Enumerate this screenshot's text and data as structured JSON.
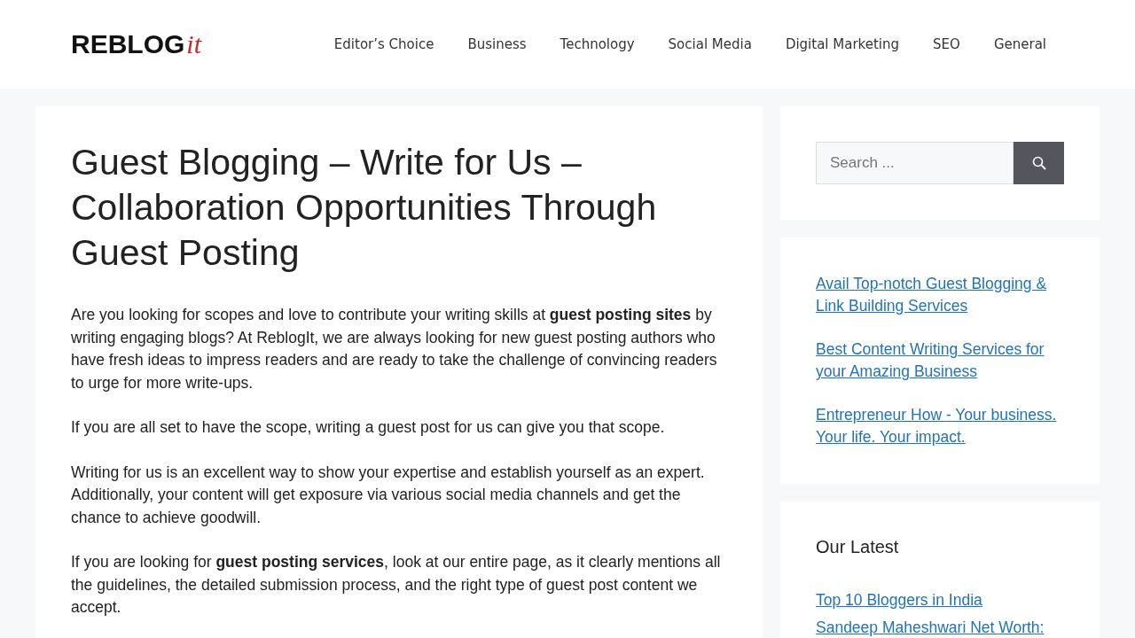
{
  "header": {
    "logo": {
      "main": "REBLOG",
      "accent": "it"
    },
    "nav": [
      {
        "label": "Editor’s Choice"
      },
      {
        "label": "Business"
      },
      {
        "label": "Technology"
      },
      {
        "label": "Social Media"
      },
      {
        "label": "Digital Marketing"
      },
      {
        "label": "SEO"
      },
      {
        "label": "General"
      }
    ]
  },
  "article": {
    "title": "Guest Blogging – Write for Us – Collaboration Opportunities Through Guest Posting",
    "paragraphs": [
      "Are you looking for scopes and love to contribute your writing skills at **guest posting sites** by writing engaging blogs? At ReblogIt, we are always looking for new guest posting authors who have fresh ideas to impress readers and are ready to take the challenge of convincing readers to urge for more write-ups.",
      "If you are all set to have the scope, writing a guest post for us can give you that scope.",
      "Writing for us is an excellent way to show your expertise and establish yourself as an expert. Additionally, your content will get exposure via various social media channels and get the chance to achieve goodwill.",
      "If you are looking for **guest posting services**, look at our entire page, as it clearly mentions all the guidelines, the detailed submission process, and the right type of guest post content we accept."
    ]
  },
  "sidebar": {
    "search": {
      "placeholder": "Search ..."
    },
    "links": [
      "Avail Top-notch Guest Blogging & Link Building Services",
      "Best Content Writing Services for your Amazing Business",
      "Entrepreneur How - Your business. Your life. Your impact."
    ],
    "latest": {
      "title": "Our Latest",
      "links": [
        "Top 10 Bloggers in India",
        "Sandeep Maheshwari Net Worth:"
      ]
    }
  }
}
